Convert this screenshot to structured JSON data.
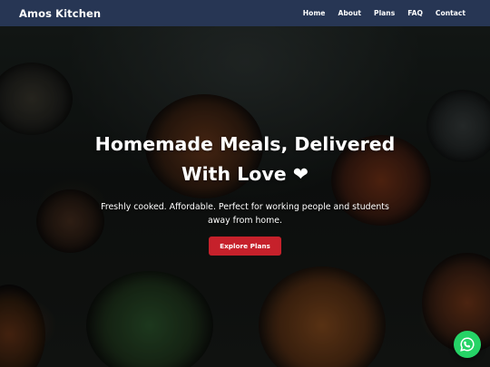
{
  "navbar": {
    "brand": "Amos Kitchen",
    "links": [
      {
        "label": "Home"
      },
      {
        "label": "About"
      },
      {
        "label": "Plans"
      },
      {
        "label": "FAQ"
      },
      {
        "label": "Contact"
      }
    ],
    "background_color": "#273654"
  },
  "hero": {
    "title": "Homemade Meals, Delivered With Love ❤",
    "subtitle": "Freshly cooked. Affordable. Perfect for working people and students away from home.",
    "cta_label": "Explore Plans",
    "cta_color": "#c6212b"
  },
  "floating": {
    "icon": "whatsapp-icon",
    "color": "#25d366"
  }
}
